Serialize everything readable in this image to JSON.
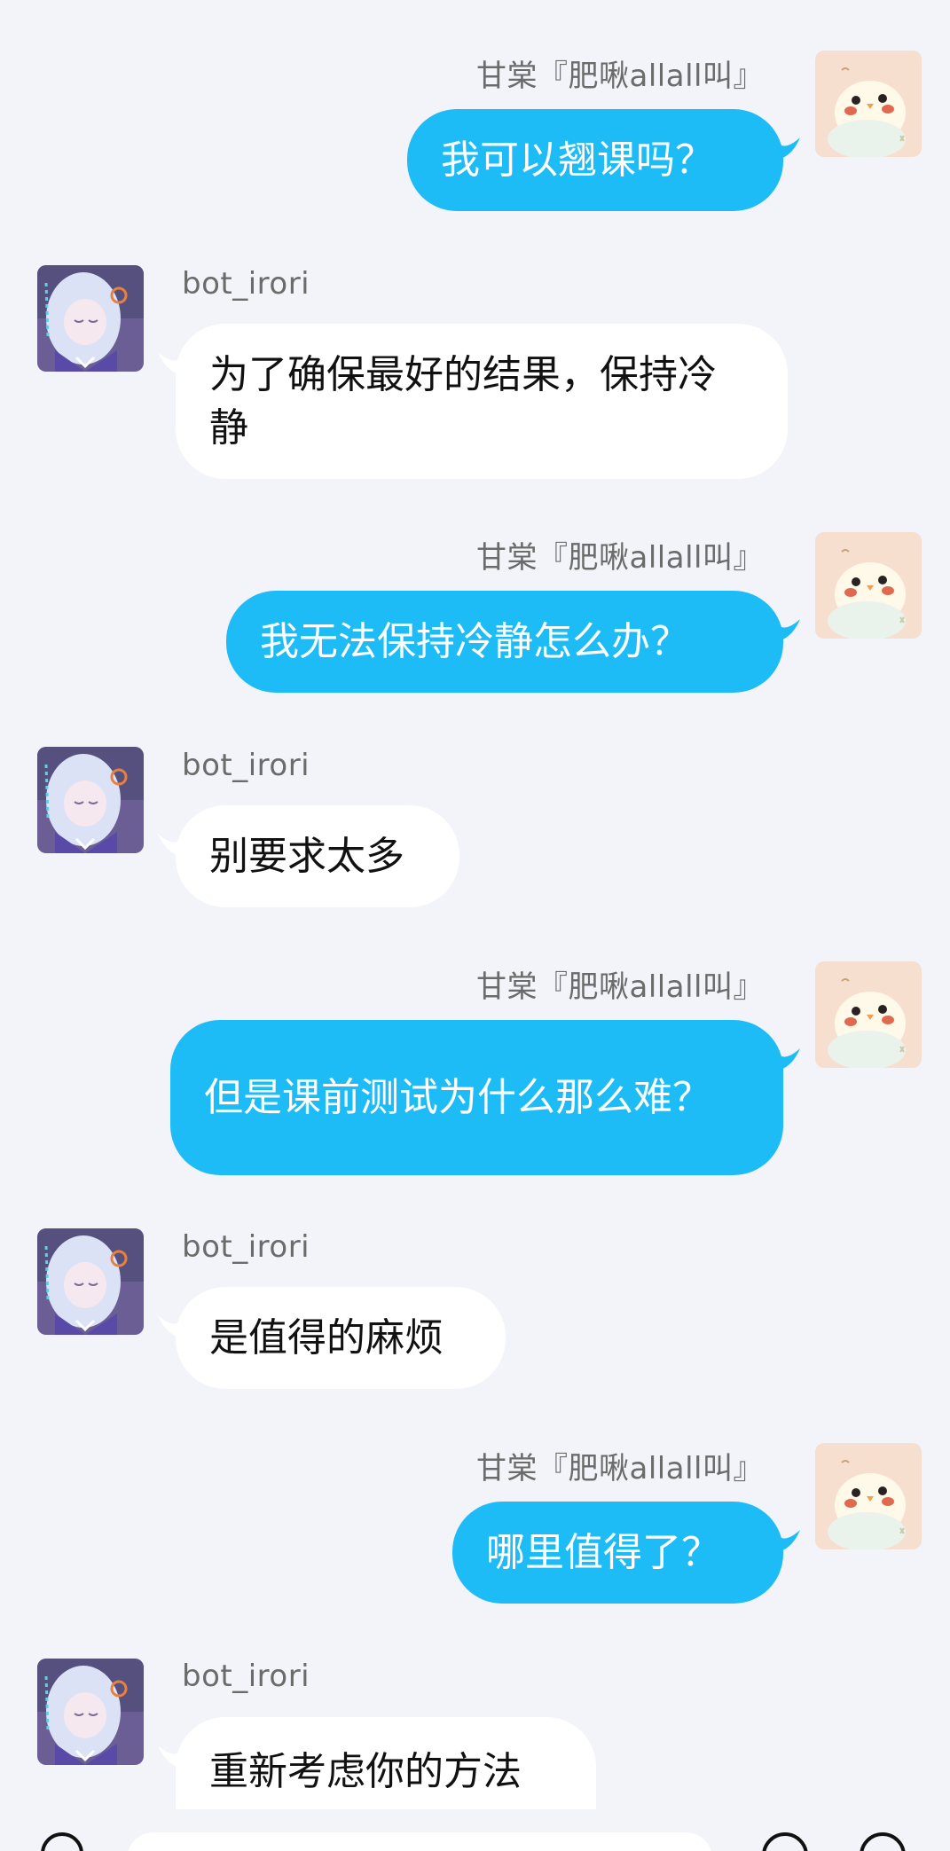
{
  "chat": {
    "participants": {
      "user": {
        "name": "甘棠『肥啾allall叫』",
        "avatar_icon": "chick-avatar-icon"
      },
      "bot": {
        "name": "bot_irori",
        "avatar_icon": "anime-girl-avatar-icon"
      }
    },
    "messages": [
      {
        "sender": "甘棠『肥啾allall叫』",
        "text": "我可以翘课吗？"
      },
      {
        "sender": "bot_irori",
        "text": "为了确保最好的结果，保持冷静"
      },
      {
        "sender": "甘棠『肥啾allall叫』",
        "text": "我无法保持冷静怎么办？"
      },
      {
        "sender": "bot_irori",
        "text": "别要求太多"
      },
      {
        "sender": "甘棠『肥啾allall叫』",
        "text": "但是课前测试为什么那么难？"
      },
      {
        "sender": "bot_irori",
        "text": "是值得的麻烦"
      },
      {
        "sender": "甘棠『肥啾allall叫』",
        "text": "哪里值得了？"
      },
      {
        "sender": "bot_irori",
        "text": "重新考虑你的方法"
      }
    ]
  },
  "colors": {
    "background": "#f3f4f9",
    "sent_bubble": "#1ebcf7",
    "received_bubble": "#ffffff",
    "sent_text": "#ffffff",
    "received_text": "#111111",
    "name_text": "#6b6b6b"
  }
}
